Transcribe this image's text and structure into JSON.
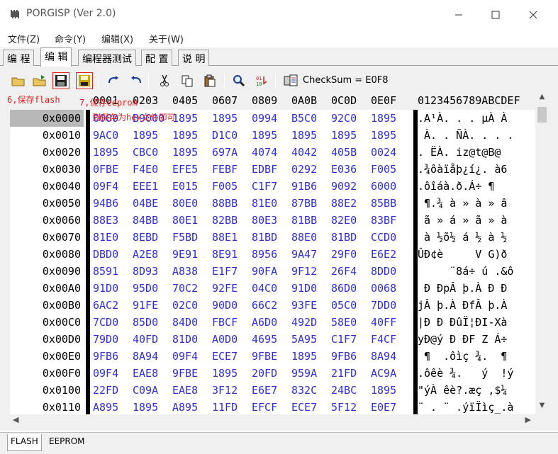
{
  "window": {
    "title": "PORGISP (Ver 2.0)"
  },
  "menu": [
    "文件(Z)",
    "命令(Y)",
    "编辑(X)",
    "关于(W)"
  ],
  "tabs": [
    "编 程",
    "编 辑",
    "编程器测试",
    "配 置",
    "说 明"
  ],
  "active_tab": "编 辑",
  "toolbar": {
    "checksum": "CheckSum = E0F8"
  },
  "annotations": {
    "save_flash": "6,保存flash",
    "save_eeprom": "7,保存eeprom",
    "hex_note": "到保存为hex文件即可"
  },
  "hex": {
    "columns": [
      "0001",
      "0203",
      "0405",
      "0607",
      "0809",
      "0A0B",
      "0C0D",
      "0E0F"
    ],
    "ascii_header": "0123456789ABCDEF",
    "rows": [
      {
        "addr": "0x0000",
        "cells": [
          "0000",
          "B9000",
          "1895",
          "1895",
          "0994",
          "B5C0",
          "92C0",
          "1895"
        ],
        "ascii": ".A¹À. . . µÀ À"
      },
      {
        "addr": "0x0010",
        "cells": [
          "9AC0",
          "1895",
          "1895",
          "D1C0",
          "1895",
          "1895",
          "1895",
          "1895"
        ],
        "ascii": " À. . ÑÀ. . . ."
      },
      {
        "addr": "0x0020",
        "cells": [
          "1895",
          "CBC0",
          "1895",
          "697A",
          "4074",
          "4042",
          "405B",
          "0024"
        ],
        "ascii": ". ËÀ. iz@t@B@"
      },
      {
        "addr": "0x0030",
        "cells": [
          "0FBE",
          "F4E0",
          "EFE5",
          "FEBF",
          "EDBF",
          "0292",
          "E036",
          "F005"
        ],
        "ascii": ".¾ôàïåþ¿í¿. à6"
      },
      {
        "addr": "0x0040",
        "cells": [
          "09F4",
          "EEE1",
          "E015",
          "F005",
          "C1F7",
          "91B6",
          "9092",
          "6000"
        ],
        "ascii": ".ôîáà.ð.Á÷ ¶"
      },
      {
        "addr": "0x0050",
        "cells": [
          "94B6",
          "04BE",
          "80E0",
          "88BB",
          "81E0",
          "87BB",
          "88E2",
          "85BB"
        ],
        "ascii": " ¶.¾ à » à » â"
      },
      {
        "addr": "0x0060",
        "cells": [
          "88E3",
          "84BB",
          "80E1",
          "82BB",
          "80E3",
          "81BB",
          "82E0",
          "83BF"
        ],
        "ascii": " ã » á » ã » à"
      },
      {
        "addr": "0x0070",
        "cells": [
          "81E0",
          "8EBD",
          "F5BD",
          "88E1",
          "81BD",
          "88E0",
          "81BD",
          "CCD0"
        ],
        "ascii": " à ½õ½ á ½ à ½"
      },
      {
        "addr": "0x0080",
        "cells": [
          "DBD0",
          "A2E8",
          "9E91",
          "8E91",
          "8956",
          "9A47",
          "29F0",
          "E6E2"
        ],
        "ascii": "ÛÐ¢è     V G)ð"
      },
      {
        "addr": "0x0090",
        "cells": [
          "8591",
          "8D93",
          "A838",
          "E1F7",
          "90FA",
          "9F12",
          "26F4",
          "8DD0"
        ],
        "ascii": "     ¨8á÷ ú .&ô"
      },
      {
        "addr": "0x00A0",
        "cells": [
          "91D0",
          "95D0",
          "70C2",
          "92FE",
          "04C0",
          "91D0",
          "86D0",
          "0068"
        ],
        "ascii": " Ð ÐpÂ þ.À Ð Ð"
      },
      {
        "addr": "0x00B0",
        "cells": [
          "6AC2",
          "91FE",
          "02C0",
          "90D0",
          "66C2",
          "93FE",
          "05C0",
          "7DD0"
        ],
        "ascii": "jÂ þ.À ÐfÂ þ.À"
      },
      {
        "addr": "0x00C0",
        "cells": [
          "7CD0",
          "85D0",
          "84D0",
          "FBCF",
          "A6D0",
          "492D",
          "58E0",
          "40FF"
        ],
        "ascii": "|Ð Ð ÐûÏ¦ÐI-Xà"
      },
      {
        "addr": "0x00D0",
        "cells": [
          "79D0",
          "40FD",
          "81D0",
          "A0D0",
          "4695",
          "5A95",
          "C1F7",
          "F4CF"
        ],
        "ascii": "yÐ@ý Ð ÐF Z Á÷"
      },
      {
        "addr": "0x00E0",
        "cells": [
          "9FB6",
          "8A94",
          "09F4",
          "ECE7",
          "9FBE",
          "1895",
          "9FB6",
          "8A94"
        ],
        "ascii": " ¶  .ôìç ¾.  ¶"
      },
      {
        "addr": "0x00F0",
        "cells": [
          "09F4",
          "EAE8",
          "9FBE",
          "1895",
          "20FD",
          "959A",
          "21FD",
          "AC9A"
        ],
        "ascii": ".ôêè ¾.   ý  !ý"
      },
      {
        "addr": "0x0100",
        "cells": [
          "22FD",
          "C09A",
          "EAE8",
          "3F12",
          "E6E7",
          "832C",
          "24BC",
          "1895"
        ],
        "ascii": "\"ýÀ êè?.æç ,$¼"
      },
      {
        "addr": "0x0110",
        "cells": [
          "A895",
          "1895",
          "A895",
          "11FD",
          "EFCF",
          "ECE7",
          "5F12",
          "E0E7"
        ],
        "ascii": "¨ . ¨ .ýïÏìç_.à"
      }
    ]
  },
  "bottom_tabs": [
    "FLASH",
    "EEPROM"
  ],
  "active_bottom_tab": "FLASH",
  "colors": {
    "accent_red": "#e02020",
    "hex_blue": "#3030d0"
  }
}
